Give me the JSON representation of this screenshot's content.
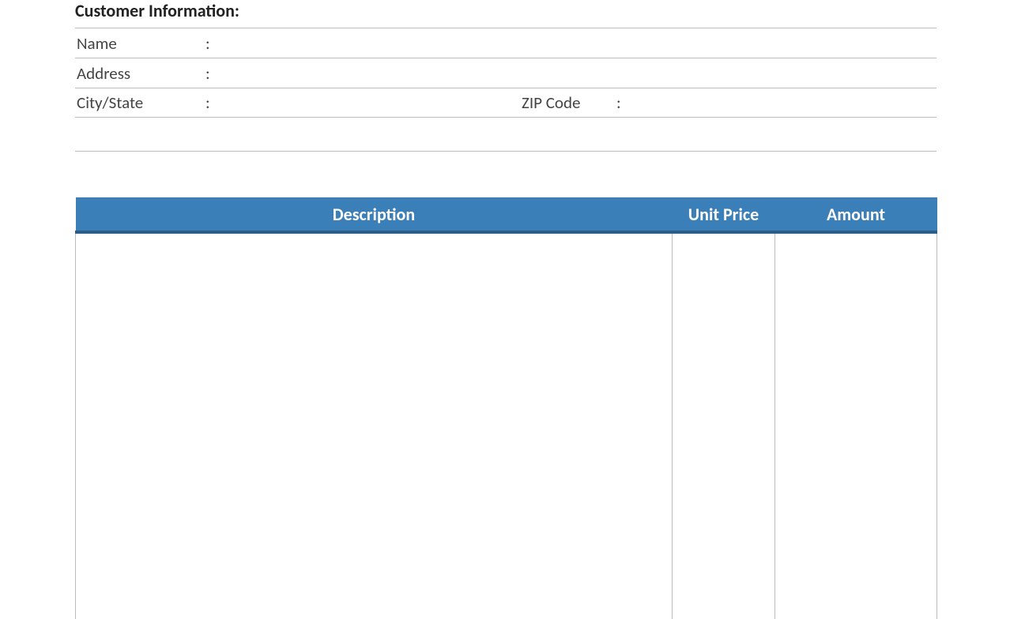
{
  "customer": {
    "section_title": "Customer Information:",
    "name_label": "Name",
    "name_value": "",
    "address_label": "Address",
    "address_value": "",
    "citystate_label": "City/State",
    "citystate_value": "",
    "zip_label": "ZIP Code",
    "zip_value": "",
    "colon": ":"
  },
  "table": {
    "headers": {
      "description": "Description",
      "unit_price": "Unit Price",
      "amount": "Amount"
    }
  },
  "colors": {
    "header_bg": "#3b7fb8",
    "header_border": "#2a5d8a",
    "line": "#bcbcbc"
  }
}
